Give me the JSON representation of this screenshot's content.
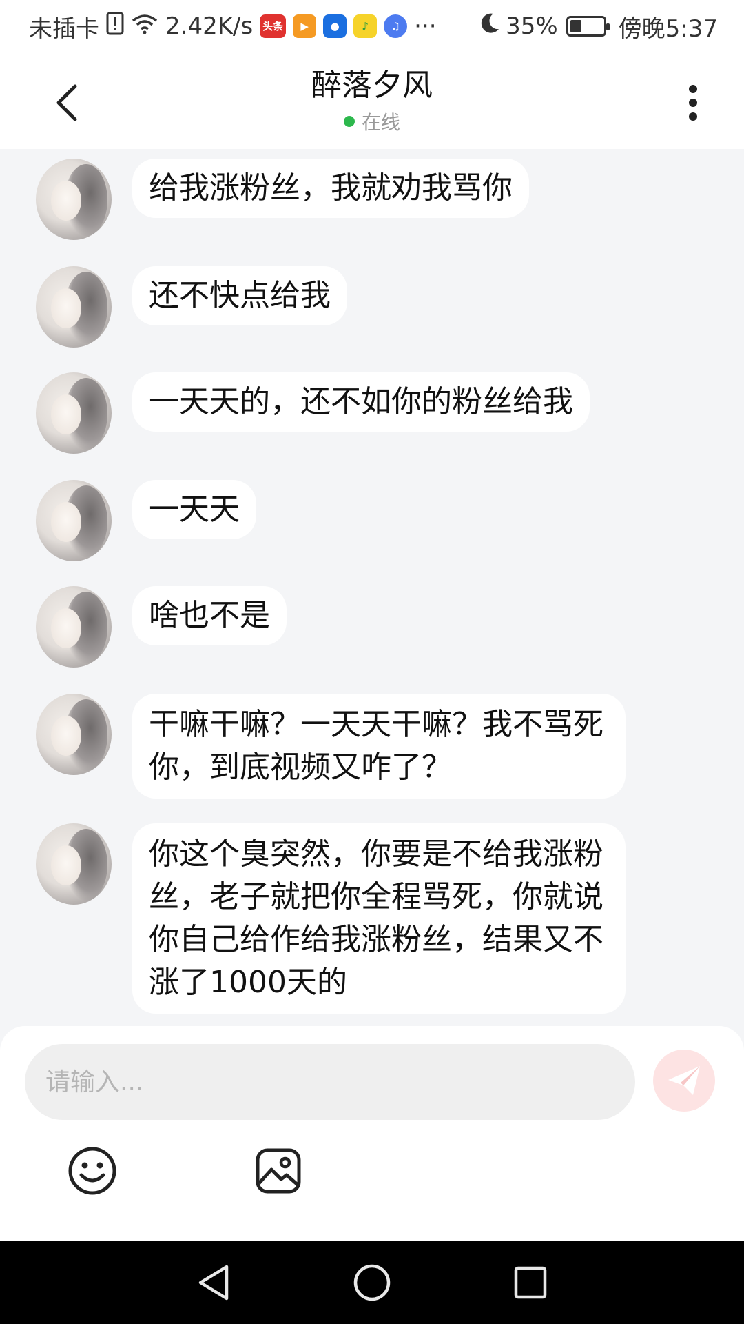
{
  "status_bar": {
    "carrier": "未插卡",
    "net_speed": "2.42K/s",
    "app_icons": [
      "头条"
    ],
    "more": "···",
    "battery": "35%",
    "battery_level": 0.35,
    "time": "傍晚5:37"
  },
  "header": {
    "title": "醉落夕风",
    "status": "在线",
    "status_color": "#2db84d",
    "back_icon": "chevron-left-icon",
    "more_icon": "vertical-dots-icon"
  },
  "messages": [
    {
      "text": "给我涨粉丝，我就劝我骂你"
    },
    {
      "text": "还不快点给我"
    },
    {
      "text": "一天天的，还不如你的粉丝给我"
    },
    {
      "text": "一天天"
    },
    {
      "text": "啥也不是"
    },
    {
      "text": "干嘛干嘛？一天天干嘛？我不骂死你，到底视频又咋了？"
    },
    {
      "text": "你这个臭突然，你要是不给我涨粉丝，老子就把你全程骂死，你就说你自己给作给我涨粉丝，结果又不涨了1000天的"
    }
  ],
  "input": {
    "placeholder": "请输入...",
    "value": ""
  },
  "toolbar": {
    "emoji_icon": "emoji-icon",
    "image_icon": "image-icon",
    "send_icon": "send-icon"
  },
  "nav": {
    "back_icon": "triangle-back-icon",
    "home_icon": "circle-home-icon",
    "recents_icon": "square-recents-icon"
  }
}
